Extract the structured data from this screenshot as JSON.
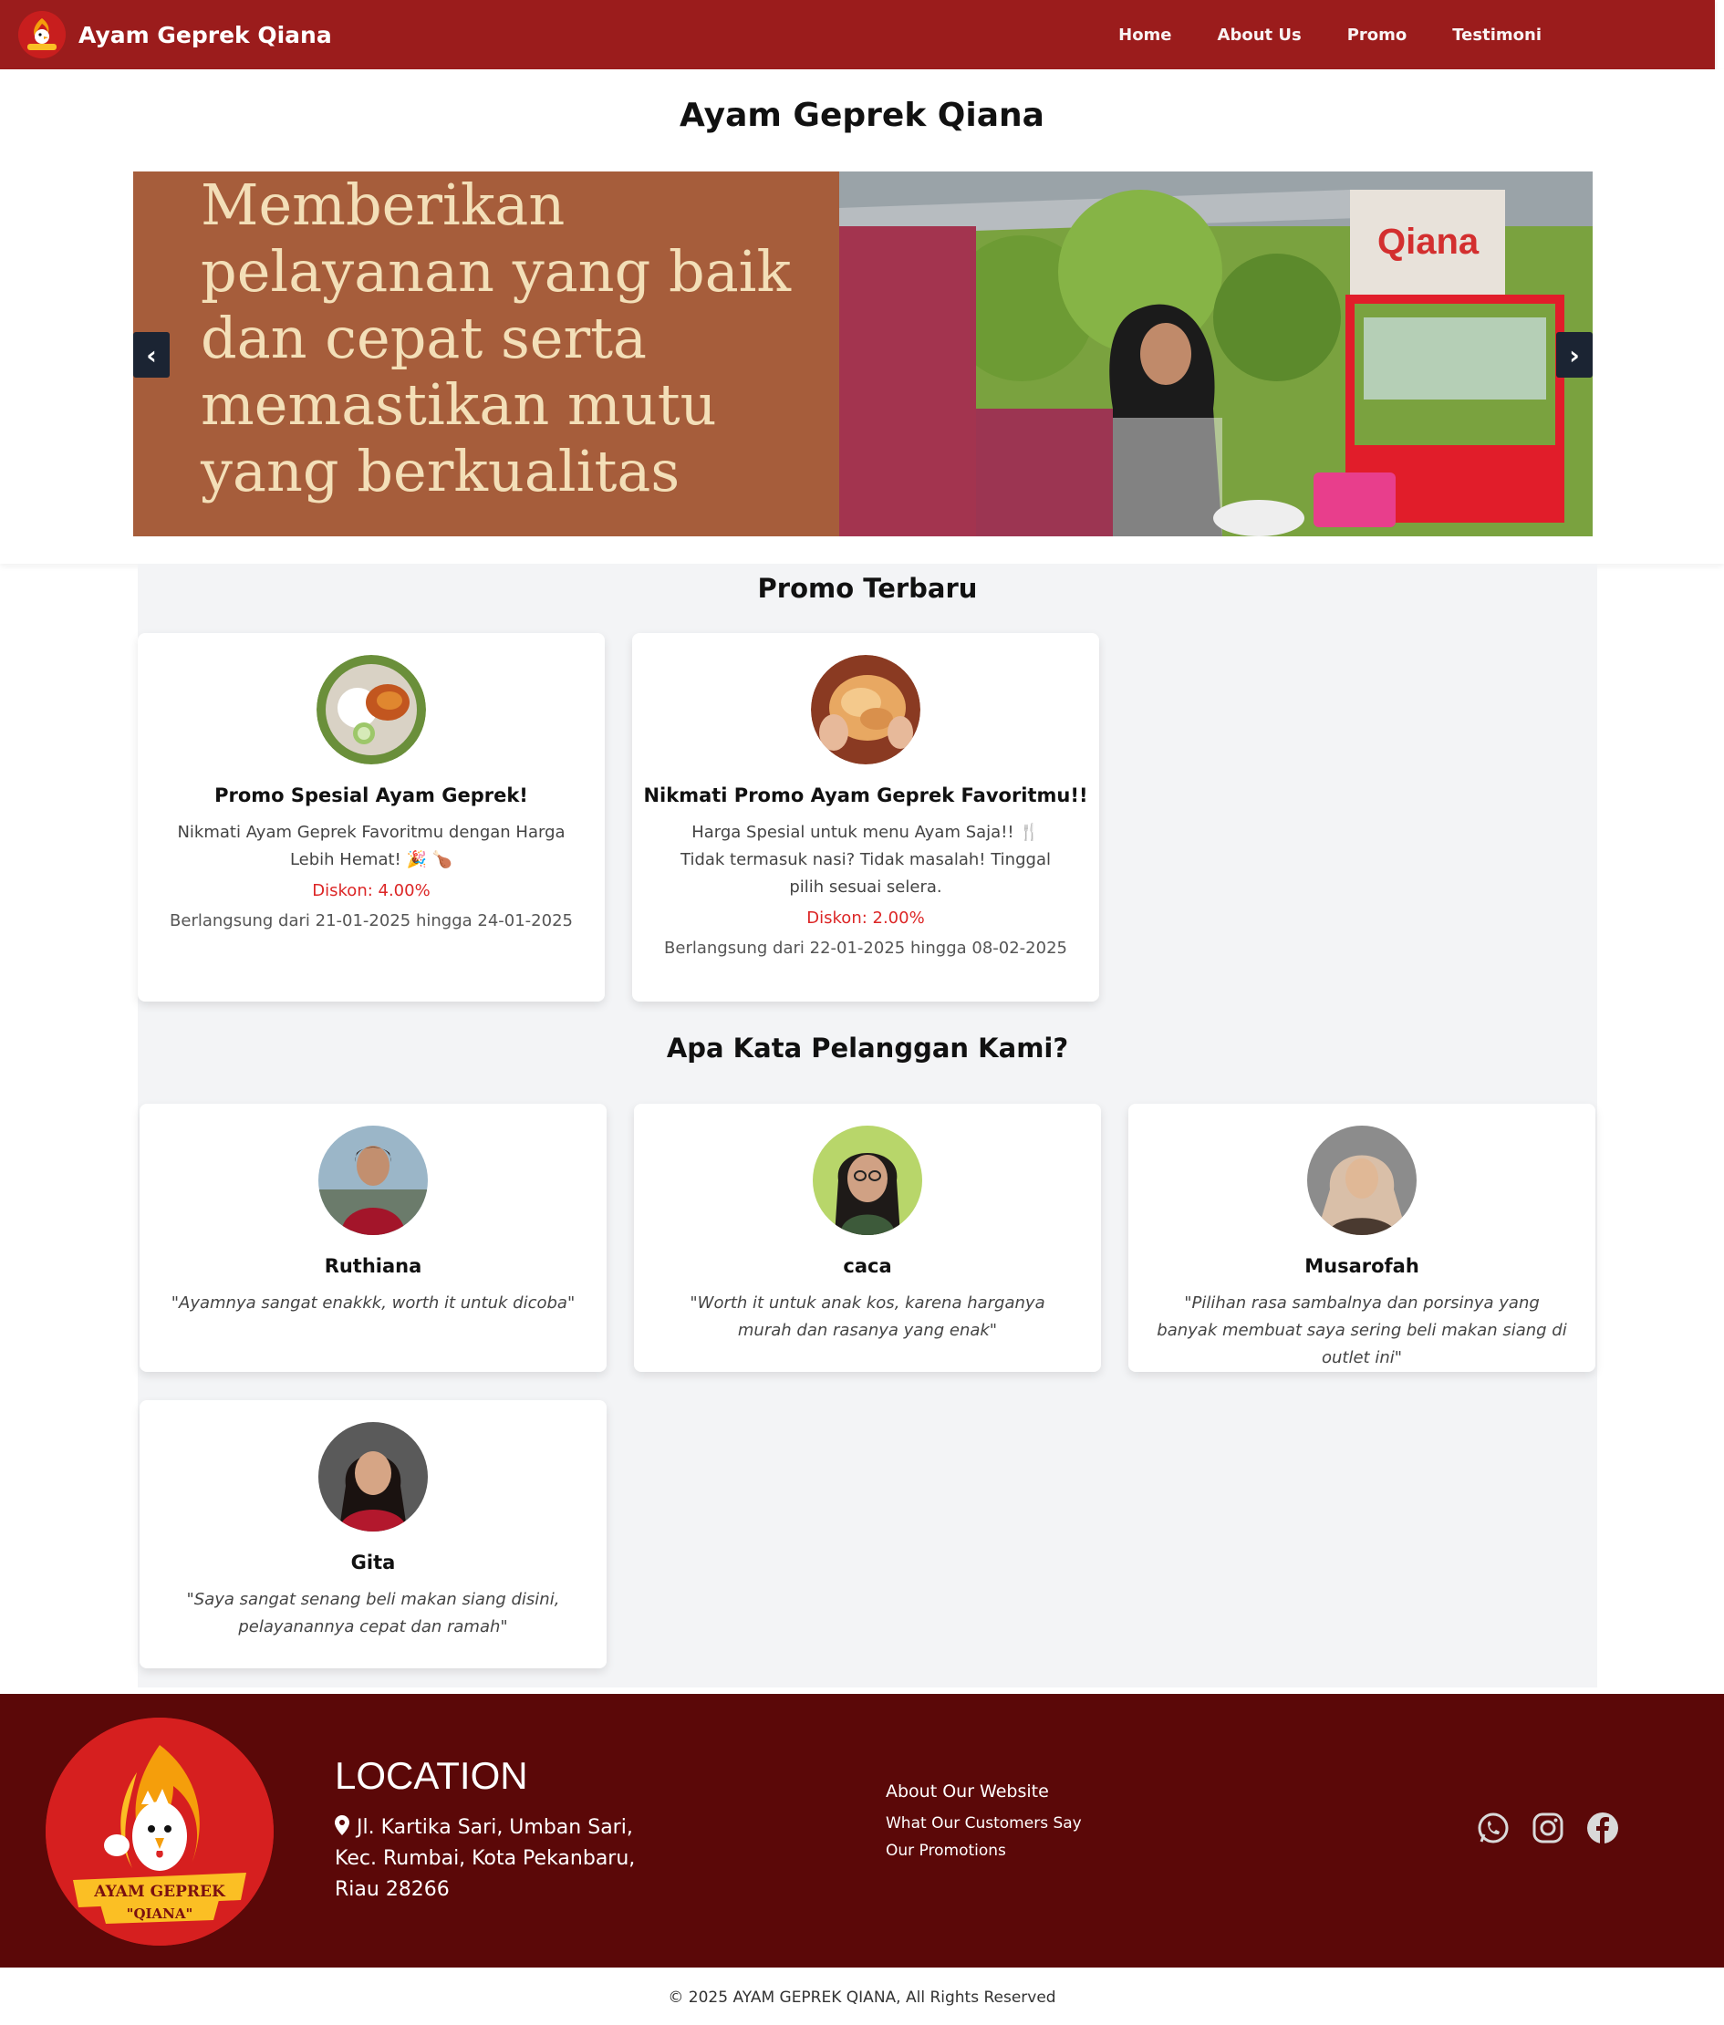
{
  "navbar": {
    "brand": "Ayam Geprek Qiana",
    "links": [
      "Home",
      "About Us",
      "Promo",
      "Testimoni"
    ]
  },
  "hero": {
    "title": "Ayam Geprek Qiana",
    "slide_text": "Memberikan pelayanan yang baik dan cepat serta memastikan mutu yang berkualitas",
    "prev": "‹",
    "next": "›"
  },
  "promo": {
    "title": "Promo Terbaru",
    "cards": [
      {
        "title": "Promo Spesial Ayam Geprek!",
        "desc": "Nikmati Ayam Geprek Favoritmu dengan Harga Lebih Hemat! 🎉 🍗",
        "discount": "Diskon: 4.00%",
        "date": "Berlangsung dari 21-01-2025 hingga 24-01-2025"
      },
      {
        "title": "Nikmati Promo Ayam Geprek Favoritmu!!",
        "desc": "Harga Spesial untuk menu Ayam Saja!! 🍴 Tidak termasuk nasi? Tidak masalah! Tinggal pilih sesuai selera.",
        "discount": "Diskon: 2.00%",
        "date": "Berlangsung dari 22-01-2025 hingga 08-02-2025"
      }
    ]
  },
  "testimoni": {
    "title": "Apa Kata Pelanggan Kami?",
    "items": [
      {
        "name": "Ruthiana",
        "text": "\"Ayamnya sangat enakkk, worth it untuk dicoba\""
      },
      {
        "name": "caca",
        "text": "\"Worth it untuk anak kos, karena harganya murah dan rasanya yang enak\""
      },
      {
        "name": "Musarofah",
        "text": "\"Pilihan rasa sambalnya dan porsinya yang banyak membuat saya sering beli makan siang di outlet ini\""
      },
      {
        "name": "Gita",
        "text": "\"Saya sangat senang beli makan siang disini, pelayanannya cepat dan ramah\""
      }
    ]
  },
  "footer": {
    "logo_text_1": "AYAM GEPREK",
    "logo_text_2": "\"QIANA\"",
    "location_title": "LOCATION",
    "address": "Jl. Kartika Sari, Umban Sari, Kec. Rumbai, Kota Pekanbaru, Riau 28266",
    "about": "About Our Website",
    "link_1": "What Our Customers Say",
    "link_2": "Our Promotions",
    "socials": [
      "whatsapp-icon",
      "instagram-icon",
      "facebook-icon"
    ],
    "copyright": "© 2025 AYAM GEPREK QIANA, All Rights Reserved"
  },
  "colors": {
    "navbar": "#9b1c1c",
    "footer": "#5b0808",
    "slide_bg": "#a65d3b",
    "slide_text": "#f3dfb8",
    "discount": "#dc2626",
    "section_bg": "#f3f4f6"
  }
}
